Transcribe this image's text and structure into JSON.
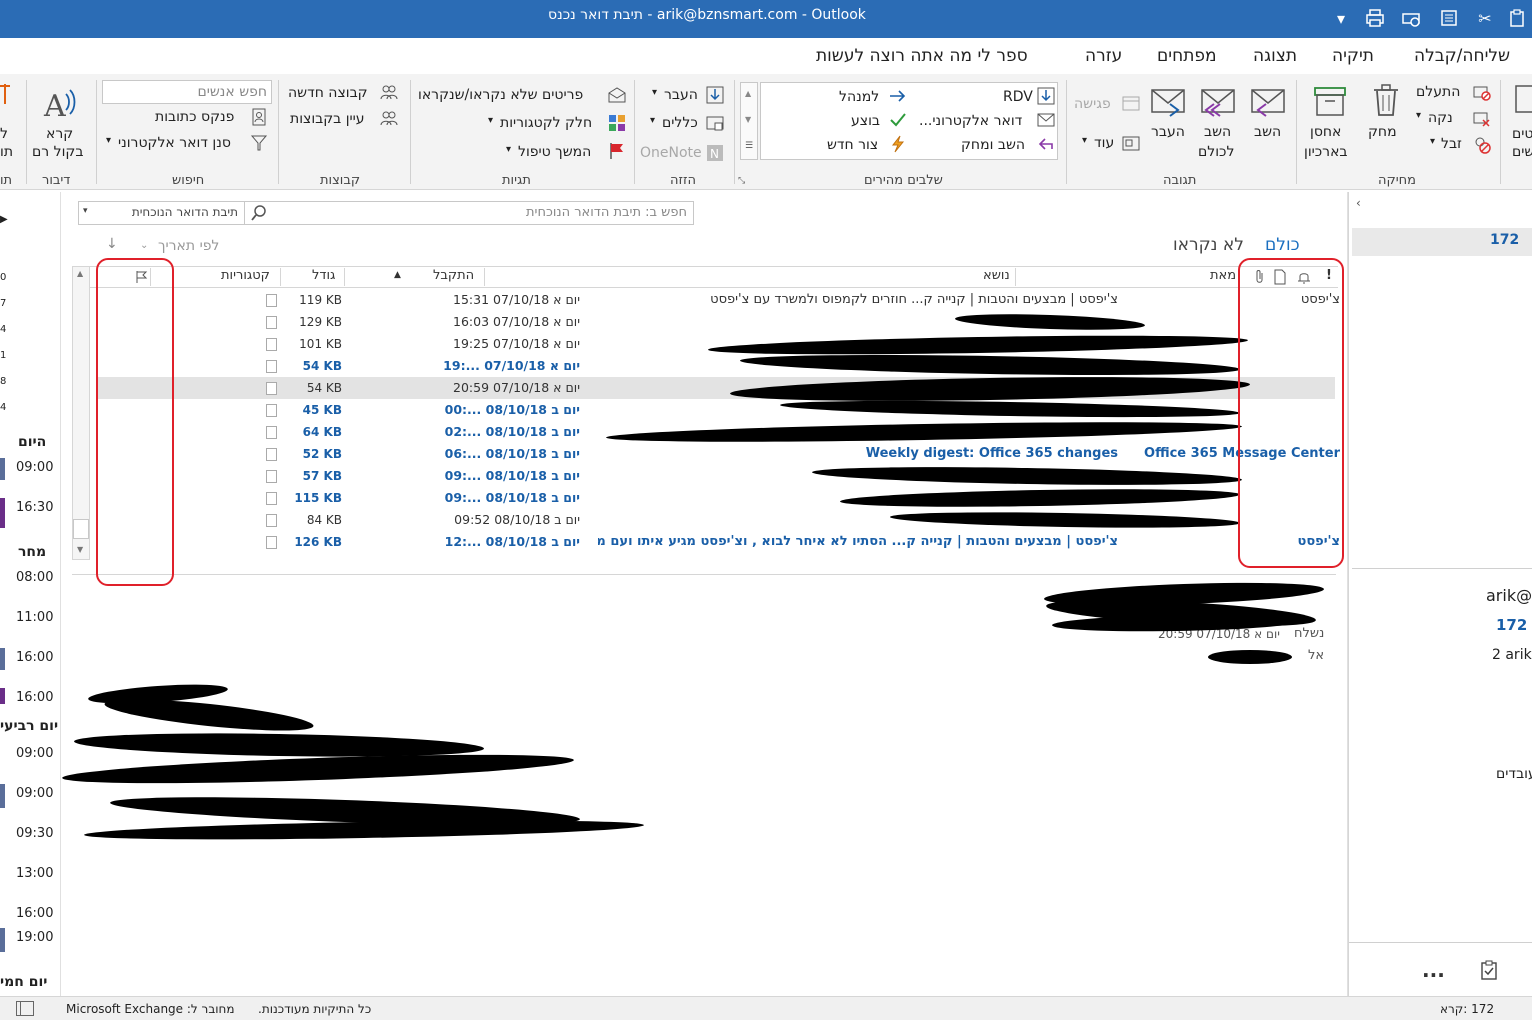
{
  "window": {
    "title": "תיבת דואר נכנס - arik@bznsmart.com - Outlook"
  },
  "menu": {
    "tabs": [
      "שליחה/קבלה",
      "תיקיה",
      "תצוגה",
      "מפתחים",
      "עזרה"
    ],
    "tell_me": "ספר לי מה אתה רוצה לעשות"
  },
  "ribbon": {
    "delete_group": {
      "label": "מחיקה",
      "ignore": "התעלם",
      "cleanup": "נקה",
      "junk": "זבל",
      "delete": "מחק",
      "archive_line1": "אחסן",
      "archive_line2": "בארכיון"
    },
    "respond_group": {
      "label": "תגובה",
      "reply": "השב",
      "reply_all_line1": "השב",
      "reply_all_line2": "לכולם",
      "forward": "העבר",
      "meeting": "פגישה",
      "more": "עוד"
    },
    "quick_steps": {
      "label": "שלבים מהירים",
      "items": [
        "RDV",
        "למנהל",
        "דואר אלקטרוני...",
        "בוצע",
        "השב ומחק",
        "צור חדש"
      ]
    },
    "move_group": {
      "label": "הזזה",
      "move": "העבר",
      "rules": "כללים",
      "onenote": "OneNote"
    },
    "tags_group": {
      "label": "תגיות",
      "unread_read": "פריטים שלא נקראו/שנקראו",
      "categorize": "חלק לקטגוריות",
      "follow_up": "המשך טיפול"
    },
    "groups_group": {
      "label": "קבוצות",
      "new_group": "קבוצה חדשה",
      "browse_groups": "עיין בקבוצות"
    },
    "find_group": {
      "label": "חיפוש",
      "search_people_placeholder": "חפש אנשים",
      "address_book": "פנקס כתובות",
      "filter_email": "סנן דואר אלקטרוני"
    },
    "speech_group": {
      "label": "דיבור",
      "read_aloud_line1": "קרא",
      "read_aloud_line2": "בקול רם"
    },
    "cut_left": {
      "label": "תו",
      "line1": "ל",
      "line2": "תו"
    },
    "cut_right": {
      "line1": "טים",
      "line2": "שים"
    }
  },
  "search": {
    "placeholder": "חפש ב: תיבת הדואר הנוכחית",
    "scope": "תיבת הדואר הנוכחית"
  },
  "filters": {
    "all": "כולם",
    "unread": "לא נקראו",
    "sort": "לפי תאריך"
  },
  "columns": {
    "importance": "!",
    "from": "מאת",
    "subject": "נושא",
    "received": "התקבל",
    "size": "גודל",
    "categories": "קטגוריות"
  },
  "messages": [
    {
      "from": "צ'יפסט",
      "subject": "צ'יפסט | מבצעים והטבות | קנייה ק... חוזרים לקמפוס ולמשרד עם צ'יפסט",
      "received": "יום א 07/10/18 15:31",
      "size": "119 KB",
      "unread": false
    },
    {
      "from": "",
      "subject": "",
      "received": "יום א 07/10/18 16:03",
      "size": "129 KB",
      "unread": false
    },
    {
      "from": "",
      "subject": "",
      "received": "יום א 07/10/18 19:25",
      "size": "101 KB",
      "unread": false
    },
    {
      "from": "",
      "subject": "",
      "received": "יום א 07/10/18 ...:19",
      "size": "54 KB",
      "unread": true
    },
    {
      "from": "",
      "subject": "",
      "received": "יום א 07/10/18 20:59",
      "size": "54 KB",
      "unread": false
    },
    {
      "from": "",
      "subject": "",
      "received": "יום ב 08/10/18 ...:00",
      "size": "45 KB",
      "unread": true
    },
    {
      "from": "",
      "subject": "",
      "received": "יום ב 08/10/18 ...:02",
      "size": "64 KB",
      "unread": true
    },
    {
      "from": "Office 365 Message Center",
      "subject": "Weekly digest: Office 365 changes",
      "received": "יום ב 08/10/18 ...:06",
      "size": "52 KB",
      "unread": true
    },
    {
      "from": "",
      "subject": "",
      "received": "יום ב 08/10/18 ...:09",
      "size": "57 KB",
      "unread": true
    },
    {
      "from": "",
      "subject": "",
      "received": "יום ב 08/10/18 ...:09",
      "size": "115 KB",
      "unread": true
    },
    {
      "from": "",
      "subject": "",
      "received": "יום ב 08/10/18 09:52",
      "size": "84 KB",
      "unread": false
    },
    {
      "from": "צ'יפסט",
      "subject": "צ'יפסט | מבצעים והטבות | קנייה ק... הסתיו לא איחר לבוא , וצ'יפסט מגיע איתו ועם מגוון מבצעים",
      "received": "יום ב 08/10/18 ...:12",
      "size": "126 KB",
      "unread": true
    }
  ],
  "reading": {
    "sent_label": "נשלח",
    "sent_value": "יום א 07/10/18 20:59",
    "to_label": "אל"
  },
  "calendar": {
    "today": "היום",
    "tomorrow": "מחר",
    "wednesday": "יום רביעי",
    "thursday": "יום חמי",
    "today_times": [
      "09:00",
      "16:30"
    ],
    "tomorrow_times": [
      "08:00",
      "11:00",
      "16:00",
      "16:00"
    ],
    "wednesday_times": [
      "09:00",
      "09:00",
      "09:30",
      "13:00",
      "16:00",
      "19:00"
    ],
    "minical_numbers": [
      "0",
      "7",
      "4",
      "1",
      "8",
      "4"
    ]
  },
  "right_pane": {
    "count": "172",
    "account": "arik@",
    "count2": "172",
    "line3": "2 arik@",
    "workers": "עובדים",
    "more": "..."
  },
  "status": {
    "items_count": "172 :קרא",
    "all_updated": "כל התיקיות מעודכנות.",
    "connected": "מחובר ל: Microsoft Exchange"
  },
  "colors": {
    "titlebar": "#2b6cb5",
    "accent": "#1a5fa8",
    "annotation": "#e0202a"
  }
}
